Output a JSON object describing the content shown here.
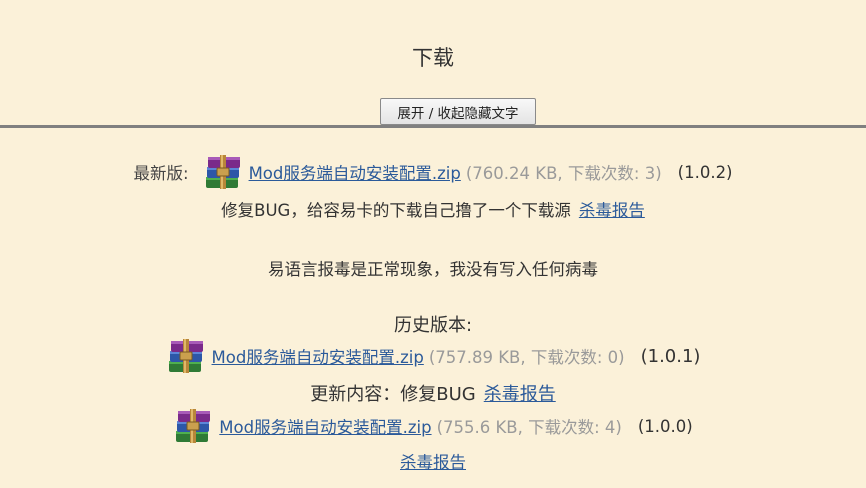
{
  "page": {
    "title": "下载",
    "toggle_label": "展开 / 收起隐藏文字"
  },
  "latest": {
    "label": "最新版:",
    "file_name": "Mod服务端自动安装配置.zip",
    "meta": "(760.24 KB, 下载次数: 3)",
    "version": "(1.0.2)",
    "note": "修复BUG，给容易卡的下载自己撸了一个下载源",
    "report_label": "杀毒报告"
  },
  "notice": "易语言报毒是正常现象，我没有写入任何病毒",
  "history": {
    "label": "历史版本:",
    "items": [
      {
        "file_name": "Mod服务端自动安装配置.zip",
        "meta": "(757.89 KB, 下载次数: 0)",
        "version": "(1.0.1)",
        "changelog": "更新内容：修复BUG",
        "report_label": "杀毒报告"
      },
      {
        "file_name": "Mod服务端自动安装配置.zip",
        "meta": "(755.6 KB, 下载次数: 4)",
        "version": "(1.0.0)",
        "report_label": "杀毒报告"
      }
    ]
  },
  "icons": {
    "file": "winrar-archive-icon"
  },
  "colors": {
    "background": "#fbf1d9",
    "link": "#2b5a9a",
    "meta_text": "#9a9a9a",
    "divider": "#808080"
  }
}
